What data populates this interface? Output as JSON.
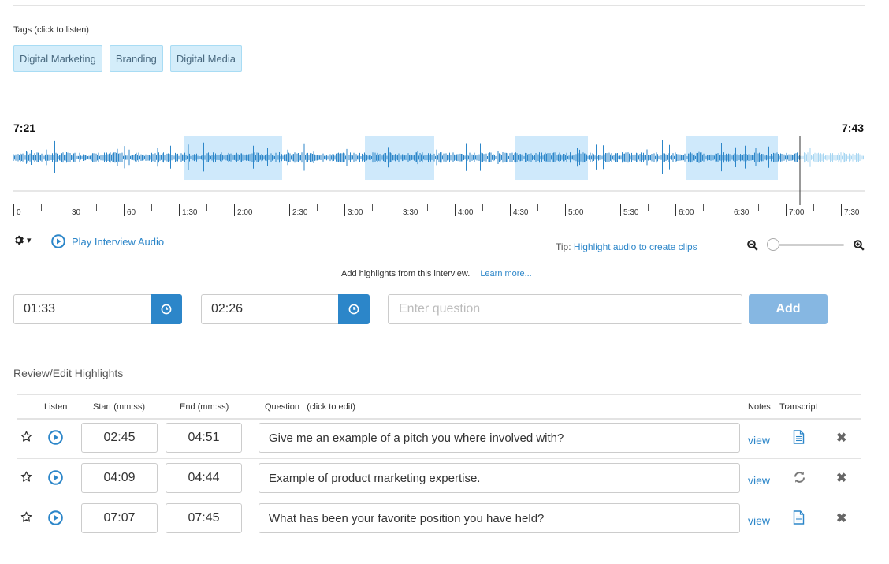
{
  "tags": {
    "label": "Tags (click to listen)",
    "items": [
      "Digital Marketing",
      "Branding",
      "Digital Media"
    ]
  },
  "waveform": {
    "start_time": "7:21",
    "end_time": "7:43",
    "ticks": [
      "0",
      "30",
      "60",
      "1:30",
      "2:00",
      "2:30",
      "3:00",
      "3:30",
      "4:00",
      "4:30",
      "5:00",
      "5:30",
      "6:00",
      "6:30",
      "7:00",
      "7:30"
    ],
    "highlight_color": "#cfe9fb",
    "wave_color": "#2c86c9",
    "wave_remaining_color": "#a7d6f2"
  },
  "controls": {
    "gear_caret": "▾",
    "play_label": "Play Interview Audio",
    "tip_prefix": "Tip:",
    "tip_link": "Highlight audio to create clips"
  },
  "add_form": {
    "hint": "Add highlights from this interview.",
    "learn_more": "Learn more...",
    "start_value": "01:33",
    "end_value": "02:26",
    "question_placeholder": "Enter question",
    "add_label": "Add"
  },
  "review": {
    "title": "Review/Edit Highlights",
    "headers": {
      "listen": "Listen",
      "start": "Start (mm:ss)",
      "end": "End (mm:ss)",
      "question": "Question   (click to edit)",
      "notes": "Notes",
      "transcript": "Transcript"
    },
    "rows": [
      {
        "start": "02:45",
        "end": "04:51",
        "question": "Give me an example of a pitch you where involved with?",
        "notes": "view",
        "transcript_state": "document-icon"
      },
      {
        "start": "04:09",
        "end": "04:44",
        "question": "Example of product marketing expertise.",
        "notes": "view",
        "transcript_state": "sync-icon"
      },
      {
        "start": "07:07",
        "end": "07:45",
        "question": "What has been your favorite position you have held?",
        "notes": "view",
        "transcript_state": "document-icon"
      }
    ]
  }
}
